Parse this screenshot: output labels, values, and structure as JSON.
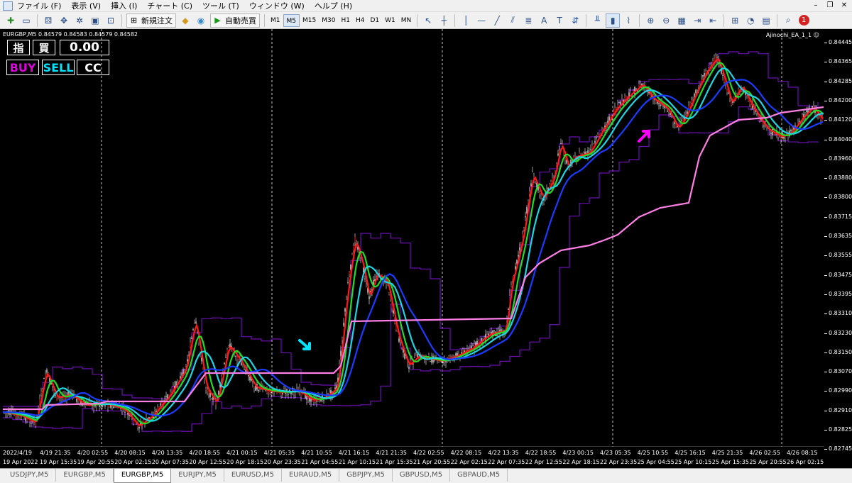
{
  "menubar": {
    "items": [
      "ファイル (F)",
      "表示 (V)",
      "挿入 (I)",
      "チャート (C)",
      "ツール (T)",
      "ウィンドウ (W)",
      "ヘルプ (H)"
    ],
    "controls": [
      "–",
      "❐",
      "✕"
    ]
  },
  "toolbar": {
    "new_order_label": "新規注文",
    "auto_trade_label": "自動売買",
    "timeframes": [
      "M1",
      "M5",
      "M15",
      "M30",
      "H1",
      "H4",
      "D1",
      "W1",
      "MN"
    ],
    "active_timeframe": "M5",
    "notification_count": "1"
  },
  "chart": {
    "symbol_info": "EURGBP,M5  0.84579 0.84583 0.84579 0.84582",
    "ea_label": "Ajinochi_EA_1_1 ☺",
    "panel": {
      "sashine_label": "指",
      "kai_label": "買",
      "lots_value": "0.00",
      "buy_label": "BUY",
      "sell_label": "SELL",
      "cc_label": "CC"
    },
    "price_axis": [
      "0.84445",
      "0.84365",
      "0.84285",
      "0.84200",
      "0.84120",
      "0.84040",
      "0.83960",
      "0.83880",
      "0.83800",
      "0.83715",
      "0.83635",
      "0.83555",
      "0.83475",
      "0.83395",
      "0.83310",
      "0.83230",
      "0.83150",
      "0.83070",
      "0.82990",
      "0.82910",
      "0.82825",
      "0.82745"
    ],
    "time_axis_top": [
      "2022/4/19",
      "4/19 21:35",
      "4/20 02:55",
      "4/20 08:15",
      "4/20 13:35",
      "4/20 18:55",
      "4/21 00:15",
      "4/21 05:35",
      "4/21 10:55",
      "4/21 16:15",
      "4/21 21:35",
      "4/22 02:55",
      "4/22 08:15",
      "4/22 13:35",
      "4/22 18:55",
      "4/23 00:15",
      "4/23 05:35",
      "4/25 10:55",
      "4/25 16:15",
      "4/25 21:35",
      "4/26 02:55",
      "4/26 08:15"
    ],
    "time_axis_bottom": [
      "19 Apr 2022",
      "19 Apr 15:35",
      "19 Apr 20:55",
      "20 Apr 02:15",
      "20 Apr 07:35",
      "20 Apr 12:55",
      "20 Apr 18:15",
      "20 Apr 23:35",
      "21 Apr 04:55",
      "21 Apr 10:15",
      "21 Apr 15:35",
      "21 Apr 20:55",
      "22 Apr 02:15",
      "22 Apr 07:35",
      "22 Apr 12:55",
      "22 Apr 18:15",
      "22 Apr 23:35",
      "25 Apr 04:55",
      "25 Apr 10:15",
      "25 Apr 15:35",
      "25 Apr 20:55",
      "26 Apr 02:15"
    ],
    "signals": [
      {
        "type": "sell",
        "color": "#00e5ff",
        "time": "4/21 05:35"
      },
      {
        "type": "buy",
        "color": "#ff00ff",
        "time": "4/23 00:15"
      }
    ],
    "indicator_colors": [
      "#ff1a1a",
      "#22dd22",
      "#1bd6e6",
      "#1a3cff",
      "#ff7fe6",
      "#6a0fb0"
    ]
  },
  "tabs": [
    "USDJPY,M5",
    "EURGBP,M5",
    "EURGBP,M5",
    "EURJPY,M5",
    "EURUSD,M5",
    "EURAUD,M5",
    "GBPJPY,M5",
    "GBPUSD,M5",
    "GBPAUD,M5"
  ],
  "active_tab": 2
}
